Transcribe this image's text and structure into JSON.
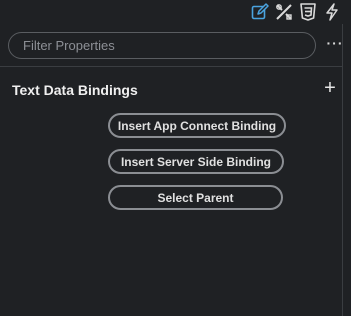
{
  "toolbar": {
    "icons": [
      "edit-icon",
      "tools-icon",
      "css-icon",
      "lightning-icon"
    ],
    "accent_color": "#4aa3df"
  },
  "filter": {
    "placeholder": "Filter Properties",
    "value": ""
  },
  "more_label": "···",
  "section": {
    "title": "Text Data Bindings",
    "add_label": "+"
  },
  "buttons": [
    {
      "label": "Insert App Connect Binding"
    },
    {
      "label": "Insert Server Side Binding"
    },
    {
      "label": "Select Parent"
    }
  ]
}
